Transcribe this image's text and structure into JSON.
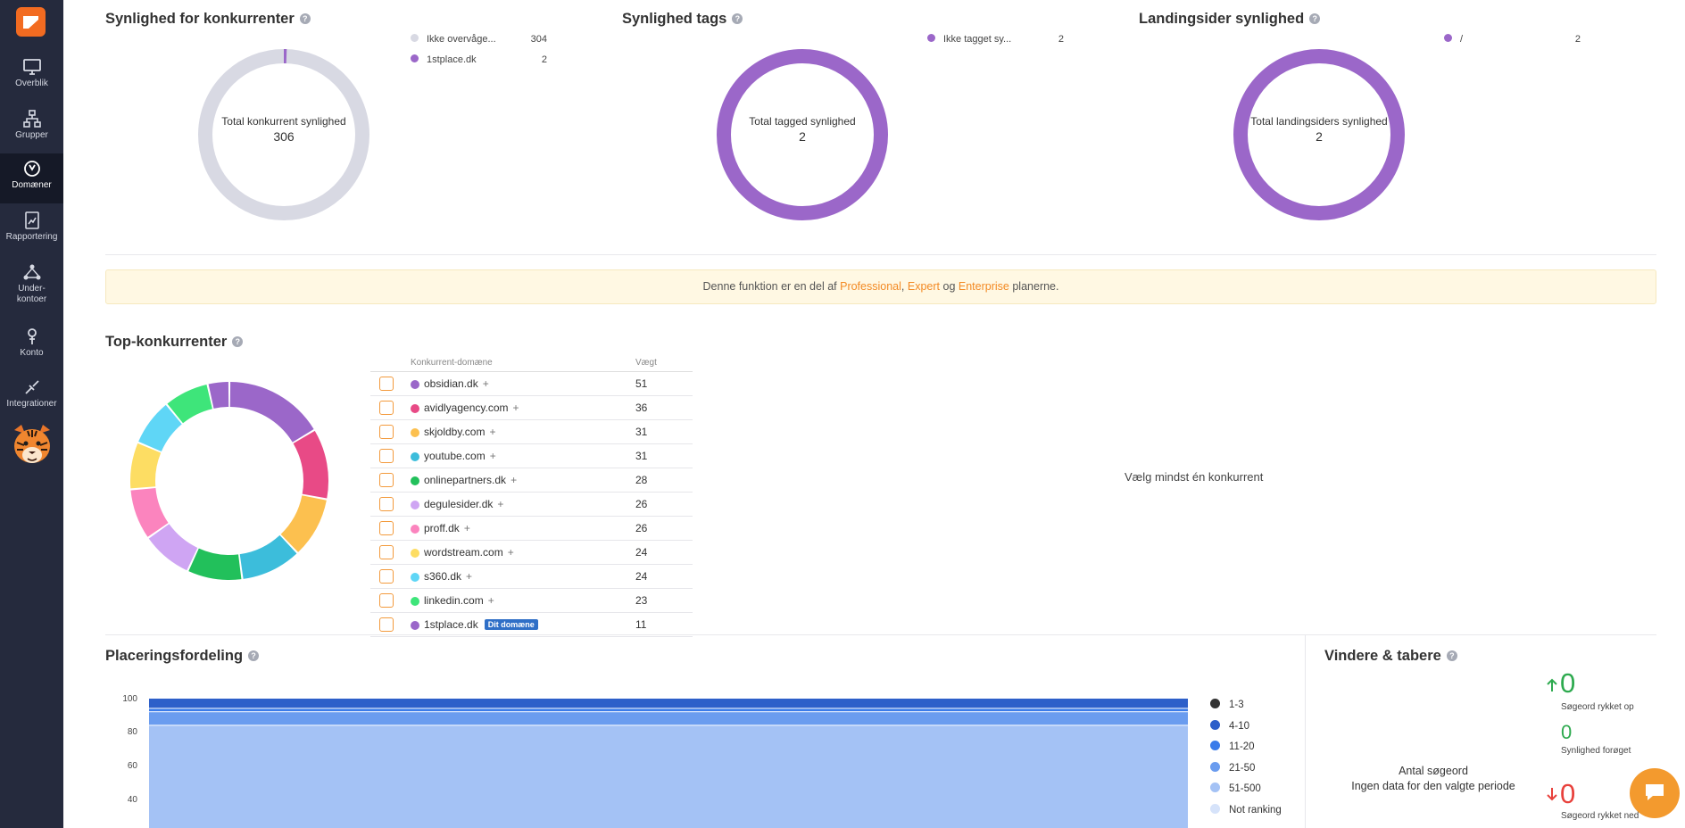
{
  "sidebar": {
    "items": [
      {
        "label": "Overblik",
        "icon": "monitor-icon"
      },
      {
        "label": "Grupper",
        "icon": "sitemap-icon"
      },
      {
        "label": "Domæner",
        "icon": "domain-icon"
      },
      {
        "label": "Rapportering",
        "icon": "report-icon"
      },
      {
        "label": "Under-",
        "label2": "kontoer",
        "icon": "subaccounts-icon"
      },
      {
        "label": "Konto",
        "icon": "account-icon"
      },
      {
        "label": "Integrationer",
        "icon": "integrations-icon"
      }
    ]
  },
  "competitors_visibility": {
    "title": "Synlighed for konkurrenter",
    "center_label": "Total konkurrent synlighed",
    "center_value": "306",
    "legend": [
      {
        "label": "Ikke overvåge...",
        "value": "304",
        "color": "#d8d9e3"
      },
      {
        "label": "1stplace.dk",
        "value": "2",
        "color": "#9b67c9"
      }
    ]
  },
  "tags_visibility": {
    "title": "Synlighed tags",
    "center_label": "Total tagged synlighed",
    "center_value": "2",
    "legend": [
      {
        "label": "Ikke tagget sy...",
        "value": "2",
        "color": "#9b67c9"
      }
    ]
  },
  "landing_visibility": {
    "title": "Landingsider synlighed",
    "center_label": "Total landingsiders synlighed",
    "center_value": "2",
    "legend": [
      {
        "label": "/",
        "value": "2",
        "color": "#9b67c9"
      }
    ]
  },
  "banner": {
    "prefix": "Denne funktion er en del af",
    "plan1": "Professional",
    "sep1": ",",
    "plan2": "Expert",
    "sep2": "og",
    "plan3": "Enterprise",
    "suffix": "planerne."
  },
  "top_competitors": {
    "title": "Top-konkurrenter",
    "col_domain": "Konkurrent-domæne",
    "col_weight": "Vægt",
    "own_badge": "Dit domæne",
    "empty_message": "Vælg mindst én konkurrent",
    "rows": [
      {
        "domain": "obsidian.dk",
        "weight": "51",
        "color": "#9b67c9"
      },
      {
        "domain": "avidlyagency.com",
        "weight": "36",
        "color": "#e84a86"
      },
      {
        "domain": "skjoldby.com",
        "weight": "31",
        "color": "#fcc04f"
      },
      {
        "domain": "youtube.com",
        "weight": "31",
        "color": "#3cbddb"
      },
      {
        "domain": "onlinepartners.dk",
        "weight": "28",
        "color": "#22c05b"
      },
      {
        "domain": "degulesider.dk",
        "weight": "26",
        "color": "#cfa5f3"
      },
      {
        "domain": "proff.dk",
        "weight": "26",
        "color": "#fb84be"
      },
      {
        "domain": "wordstream.com",
        "weight": "24",
        "color": "#fddd63"
      },
      {
        "domain": "s360.dk",
        "weight": "24",
        "color": "#5fd6f6"
      },
      {
        "domain": "linkedin.com",
        "weight": "23",
        "color": "#3ee57a"
      },
      {
        "domain": "1stplace.dk",
        "weight": "11",
        "color": "#9b67c9",
        "own": true
      }
    ]
  },
  "rank_distribution": {
    "title": "Placeringsfordeling",
    "chart_data": {
      "type": "area",
      "stacked": true,
      "ylim": [
        0,
        100
      ],
      "y_ticks": [
        "100",
        "80",
        "60",
        "40"
      ],
      "series": [
        {
          "name": "1-3",
          "value": 0,
          "color": "#333333"
        },
        {
          "name": "4-10",
          "value": 6,
          "color": "#2d5fc9"
        },
        {
          "name": "11-20",
          "value": 2,
          "color": "#3a7bea"
        },
        {
          "name": "21-50",
          "value": 8,
          "color": "#6a9cef"
        },
        {
          "name": "51-500",
          "value": 84,
          "color": "#a4c2f5"
        },
        {
          "name": "Not ranking",
          "value": 0,
          "color": "#d6e3fa"
        }
      ]
    }
  },
  "winners_losers": {
    "title": "Vindere & tabere",
    "up_value": "0",
    "up_label": "Søgeord rykket op",
    "vis_value": "0",
    "vis_label": "Synlighed forøget",
    "down_value": "0",
    "down_label": "Søgeord rykket ned",
    "center_title": "Antal søgeord",
    "center_sub": "Ingen data for den valgte periode",
    "up_color": "#2eaa4f",
    "down_color": "#e8413c"
  }
}
